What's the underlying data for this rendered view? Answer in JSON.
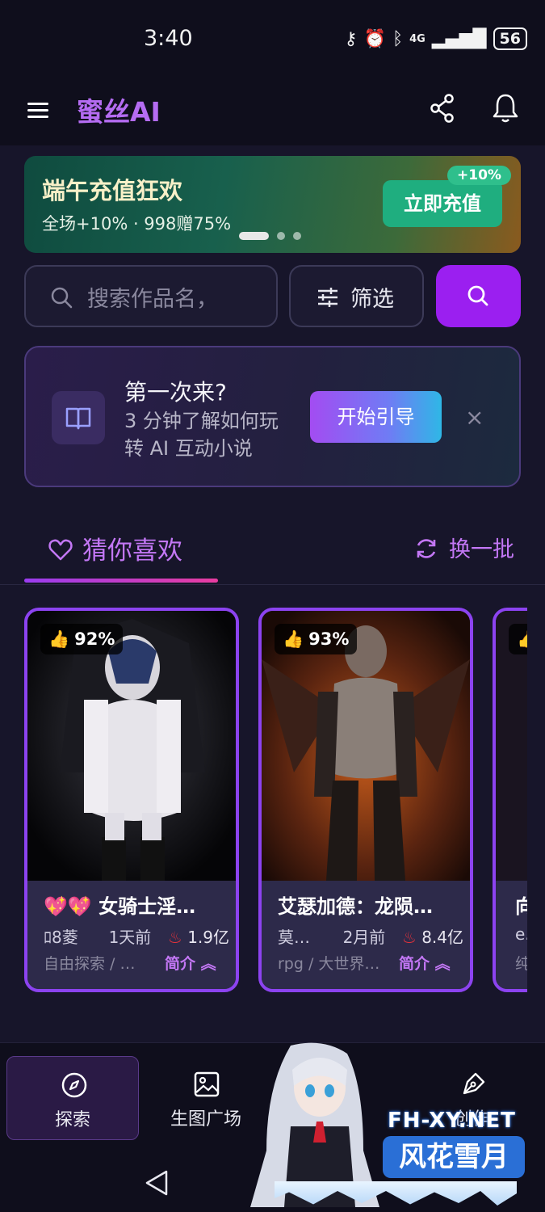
{
  "status_bar": {
    "time": "3:40",
    "network": "4G",
    "battery": "56"
  },
  "app_bar": {
    "title": "蜜丝AI"
  },
  "banner": {
    "title": "端午充值狂欢",
    "subtitle": "全场+10% · 998赠75%",
    "tag": "+10%",
    "button": "立即充值"
  },
  "search": {
    "placeholder": "搜索作品名，",
    "filter_label": "筛选"
  },
  "guide": {
    "title": "第一次来?",
    "desc": "3 分钟了解如何玩转 AI 互动小说",
    "button": "开始引导",
    "close": "×"
  },
  "section": {
    "tab_label": "猜你喜欢",
    "refresh_label": "换一批"
  },
  "cards": [
    {
      "rating": "92%",
      "title": "💖💖 女骑士淫…",
      "author": "ﾛ8菱",
      "time": "1天前",
      "heat": "1.9亿",
      "tags": "自由探索 / …",
      "intro": "简介"
    },
    {
      "rating": "93%",
      "title": "艾瑟加德：龙陨…",
      "author": "莫…",
      "time": "2月前",
      "heat": "8.4亿",
      "tags": "rpg / 大世界…",
      "intro": "简介"
    },
    {
      "rating": "",
      "title": "向",
      "author": "e.",
      "time": "",
      "heat": "",
      "tags": "纯",
      "intro": ""
    }
  ],
  "bottom_nav": [
    {
      "label": "探索",
      "icon": "compass-icon",
      "active": true
    },
    {
      "label": "生图广场",
      "icon": "image-icon",
      "active": false
    },
    {
      "label": "创作",
      "icon": "pen-icon",
      "active": false
    }
  ],
  "watermark": {
    "line1": "FH-XY.NET",
    "line2": "风花雪月"
  },
  "colors": {
    "accent": "#9b1ff0",
    "accent_text": "#c377f5",
    "card_border": "#8c43f0",
    "background": "#17152a",
    "banner_button": "#1fae7f"
  }
}
